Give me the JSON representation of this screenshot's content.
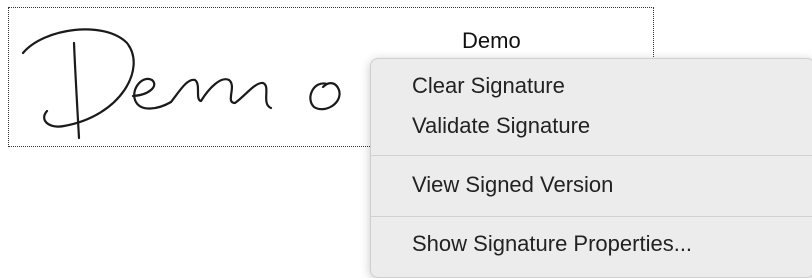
{
  "signature_field": {
    "handwritten_signature": "Demo",
    "signer_name": "Demo"
  },
  "context_menu": {
    "clear_signature": "Clear Signature",
    "validate_signature": "Validate Signature",
    "view_signed_version": "View Signed Version",
    "show_signature_properties": "Show Signature Properties..."
  }
}
